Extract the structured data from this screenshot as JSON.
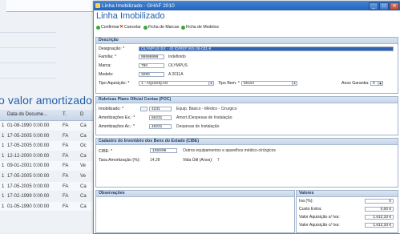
{
  "background": {
    "title": "o valor amortizado",
    "table_headers": [
      "Data do Docume...",
      "T.",
      "D"
    ],
    "rows": [
      {
        "a": "1",
        "date": "01-08-1990 0:00:00",
        "t": "FA",
        "d": "Ca"
      },
      {
        "a": "1",
        "date": "17-05-2005 0:00:00",
        "t": "FA",
        "d": "Ca"
      },
      {
        "a": "1",
        "date": "17-05-2005 0:00:00",
        "t": "FA",
        "d": "Oc"
      },
      {
        "a": "1",
        "date": "12-12-2000 0:00:00",
        "t": "FA",
        "d": "Ca"
      },
      {
        "a": "1",
        "date": "09-01-2001 0:00:00",
        "t": "FA",
        "d": "Ve"
      },
      {
        "a": "1",
        "date": "17-05-2005 0:00:00",
        "t": "FA",
        "d": "Ve"
      },
      {
        "a": "1",
        "date": "17-05-2005 0:00:00",
        "t": "FA",
        "d": "Ca"
      },
      {
        "a": "1",
        "date": "17-02-1999 0:00:00",
        "t": "FA",
        "d": "Ca"
      },
      {
        "a": "1",
        "date": "01-05-1990 0:00:00",
        "t": "FA",
        "d": "Ca"
      }
    ]
  },
  "window": {
    "title": "Linha Imobilizado - GHAF 2010",
    "heading": "Linha Imobilizado",
    "buttons": {
      "minimize": "_",
      "maximize": "□",
      "close": "✕"
    }
  },
  "toolbar": {
    "confirm": "Confirmar",
    "cancel": "Cancelar",
    "marcas": "Ficha de Marcas",
    "modelos": "Ficha de Modelos"
  },
  "descricao": {
    "header": "Descrição",
    "designacao_label": "Designação: *",
    "designacao_value": "OLYMPUS BX - 40 ID/REF:WS-36-031-6",
    "familia_label": "Família: *",
    "familia_value": "99999999",
    "familia_text": "Indefinido",
    "marca_label": "Marca:",
    "marca_value": "790",
    "marca_text": "OLYMPUS",
    "modelo_label": "Modelo:",
    "modelo_value": "3290",
    "modelo_text": "A 2011A",
    "tipo_aq_label": "Tipo Aquisição: *",
    "tipo_aq_value": "1 - AQUISIÇÃO",
    "tipo_bem_label": "Tipo Bem: *",
    "tipo_bem_value": "Móvel",
    "anos_label": "Anos Garantia:",
    "anos_value": "0"
  },
  "poc": {
    "header": "Rubricas Plano Oficial Contas (POC)",
    "imob_label": "Imobilizado: *",
    "imob_value": "4231",
    "imob_text": "Equip. Básico - Médico - Cirurgico",
    "amort_ex_label": "Amortizações Ex.: *",
    "amort_ex_value": "66231",
    "amort_ex_text": "Amort./Despesas de Instalação",
    "amort_ac_label": "Amortizações Ac.: *",
    "amort_ac_value": "48231",
    "amort_ac_text": "Despesas de Instalação"
  },
  "cibe": {
    "header": "Cadastro do Inventário dos Bens do Estado (CIBE)",
    "cibe_label": "CIBE: *",
    "cibe_value": "1350/99",
    "cibe_text": "Outros equipamentos e aparelhos médico-cirúrgicos",
    "taxa_label": "Taxa Amortização (%):",
    "taxa_value": "14,28",
    "vida_label": "Vida Útil (Anos):",
    "vida_value": "7"
  },
  "observacoes": {
    "header": "Observações"
  },
  "valores": {
    "header": "Valores",
    "iva_label": "Iva (%):",
    "iva_value": "0",
    "custo_label": "Custo Extra:",
    "custo_value": "0,00 €",
    "val_siva_label": "Valor Aquisição s/ Iva:",
    "val_siva_value": "1.612,33 €",
    "val_civa_label": "Valor Aquisição c/ Iva:",
    "val_civa_value": "1.612,33 €"
  },
  "colors": {
    "accent": "#1f5ea8",
    "titlebar": "#2563b8",
    "selection": "#2e62b8"
  }
}
